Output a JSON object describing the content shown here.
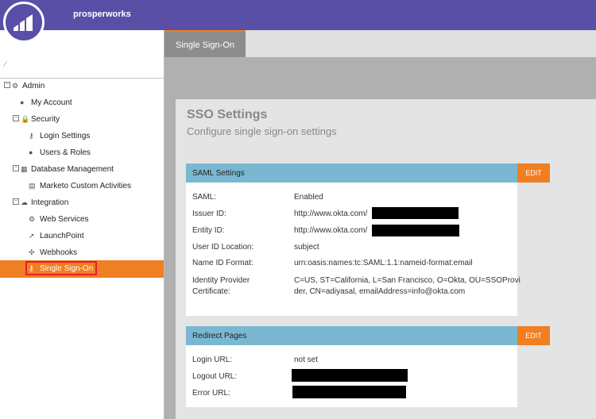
{
  "app": {
    "name": "prosperworks"
  },
  "tabs": [
    {
      "label": "Single Sign-On"
    }
  ],
  "sidebar": {
    "items": [
      {
        "label": "Admin"
      },
      {
        "label": "My Account"
      },
      {
        "label": "Security"
      },
      {
        "label": "Login Settings"
      },
      {
        "label": "Users & Roles"
      },
      {
        "label": "Database Management"
      },
      {
        "label": "Marketo Custom Activities"
      },
      {
        "label": "Integration"
      },
      {
        "label": "Web Services"
      },
      {
        "label": "LaunchPoint"
      },
      {
        "label": "Webhooks"
      },
      {
        "label": "Single Sign-On"
      }
    ]
  },
  "page": {
    "title": "SSO Settings",
    "subtitle": "Configure single sign-on settings"
  },
  "saml": {
    "header": "SAML Settings",
    "edit_label": "EDIT",
    "rows": [
      {
        "label": "SAML:",
        "value": "Enabled"
      },
      {
        "label": "Issuer ID:",
        "value": "http://www.okta.com/"
      },
      {
        "label": "Entity ID:",
        "value": "http://www.okta.com/"
      },
      {
        "label": "User ID Location:",
        "value": "subject"
      },
      {
        "label": "Name ID Format:",
        "value": "urn:oasis:names:tc:SAML:1.1:nameid-format:email"
      }
    ],
    "cert_label_1": "Identity Provider",
    "cert_label_2": "Certificate:",
    "cert_value_1": "C=US, ST=California, L=San Francisco, O=Okta, OU=SSOProvi",
    "cert_value_2": "der, CN=adiyasal, emailAddress=info@okta.com"
  },
  "redirect": {
    "header": "Redirect Pages",
    "edit_label": "EDIT",
    "rows": [
      {
        "label": "Login URL:",
        "value": "not set"
      },
      {
        "label": "Logout URL:",
        "value": ""
      },
      {
        "label": "Error URL:",
        "value": ""
      }
    ]
  }
}
